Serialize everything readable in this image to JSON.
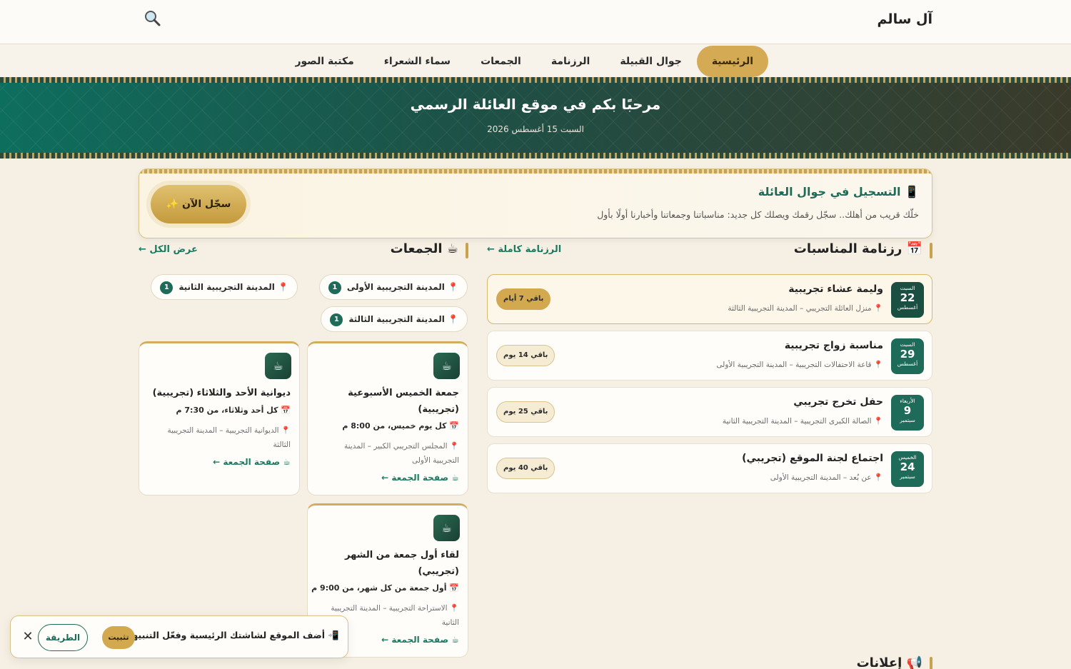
{
  "header": {
    "brand": "آل سالم",
    "search_icon": "search-icon"
  },
  "nav": {
    "items": [
      {
        "label": "الرئيسية",
        "active": true
      },
      {
        "label": "جوال القبيلة",
        "active": false
      },
      {
        "label": "الرزنامة",
        "active": false
      },
      {
        "label": "الجمعات",
        "active": false
      },
      {
        "label": "سماء الشعراء",
        "active": false
      },
      {
        "label": "مكتبة الصور",
        "active": false
      }
    ]
  },
  "hero": {
    "title": "مرحبًا بكم في موقع العائلة الرسمي",
    "date": "السبت 15 أغسطس 2026"
  },
  "register": {
    "title": "📱 التسجيل في جوال العائلة",
    "description": "خلّك قريب من أهلك.. سجّل رقمك ويصلك كل جديد: مناسباتنا وجمعاتنا وأخبارنا أولًا بأول",
    "button": "سجّل الآن ✨"
  },
  "events": {
    "title": "📅 رزنامة المناسبات",
    "link": "الرزنامة كاملة ←",
    "items": [
      {
        "day": "السبت",
        "num": "22",
        "month": "أغسطس",
        "title": "وليمة عشاء تجريبية",
        "location": "📍 منزل العائلة التجريبي – المدينة التجريبية الثالثة",
        "badge": "باقي 7 أيام"
      },
      {
        "day": "السبت",
        "num": "29",
        "month": "أغسطس",
        "title": "مناسبة زواج تجريبية",
        "location": "📍 قاعة الاحتفالات التجريبية – المدينة التجريبية الأولى",
        "badge": "باقي 14 يوم"
      },
      {
        "day": "الأربعاء",
        "num": "9",
        "month": "سبتمبر",
        "title": "حفل تخرج تجريبي",
        "location": "📍 الصالة الكبرى التجريبية – المدينة التجريبية الثانية",
        "badge": "باقي 25 يوم"
      },
      {
        "day": "الخميس",
        "num": "24",
        "month": "سبتمبر",
        "title": "اجتماع لجنة الموقع (تجريبي)",
        "location": "📍 عن بُعد – المدينة التجريبية الأولى",
        "badge": "باقي 40 يوم"
      }
    ]
  },
  "gatherings": {
    "title": "☕ الجمعات",
    "link": "عرض الكل ←",
    "chips": [
      {
        "label": "📍 المدينة التجريبية الأولى",
        "count": "1"
      },
      {
        "label": "📍 المدينة التجريبية الثانية",
        "count": "1"
      },
      {
        "label": "📍 المدينة التجريبية الثالثة",
        "count": "1"
      }
    ],
    "cards": [
      {
        "icon": "☕",
        "title": "جمعة الخميس الأسبوعية (تجريبية)",
        "time": "📅 كل يوم خميس، من 8:00 م",
        "location": "📍 المجلس التجريبي الكبير – المدينة التجريبية الأولى",
        "link": "☕ صفحة الجمعة ←"
      },
      {
        "icon": "☕",
        "title": "ديوانية الأحد والثلاثاء (تجريبية)",
        "time": "📅 كل أحد وثلاثاء، من 7:30 م",
        "location": "📍 الديوانية التجريبية – المدينة التجريبية الثالثة",
        "link": "☕ صفحة الجمعة ←"
      },
      {
        "icon": "☕",
        "title": "لقاء أول جمعة من الشهر (تجريبي)",
        "time": "📅 أول جمعة من كل شهر، من 9:00 م",
        "location": "📍 الاستراحة التجريبية – المدينة التجريبية الثانية",
        "link": "☕ صفحة الجمعة ←"
      }
    ]
  },
  "announcements": {
    "title": "📢 إعلانات"
  },
  "install": {
    "text": "📲 أضف الموقع لشاشتك الرئيسية وفعّل التنبيهات",
    "install_label": "تثبيت",
    "how_label": "الطريقة",
    "close": "✕"
  },
  "colors": {
    "primary_green": "#1d6b58",
    "gold": "#d2a94f",
    "background": "#f6f0e4"
  }
}
